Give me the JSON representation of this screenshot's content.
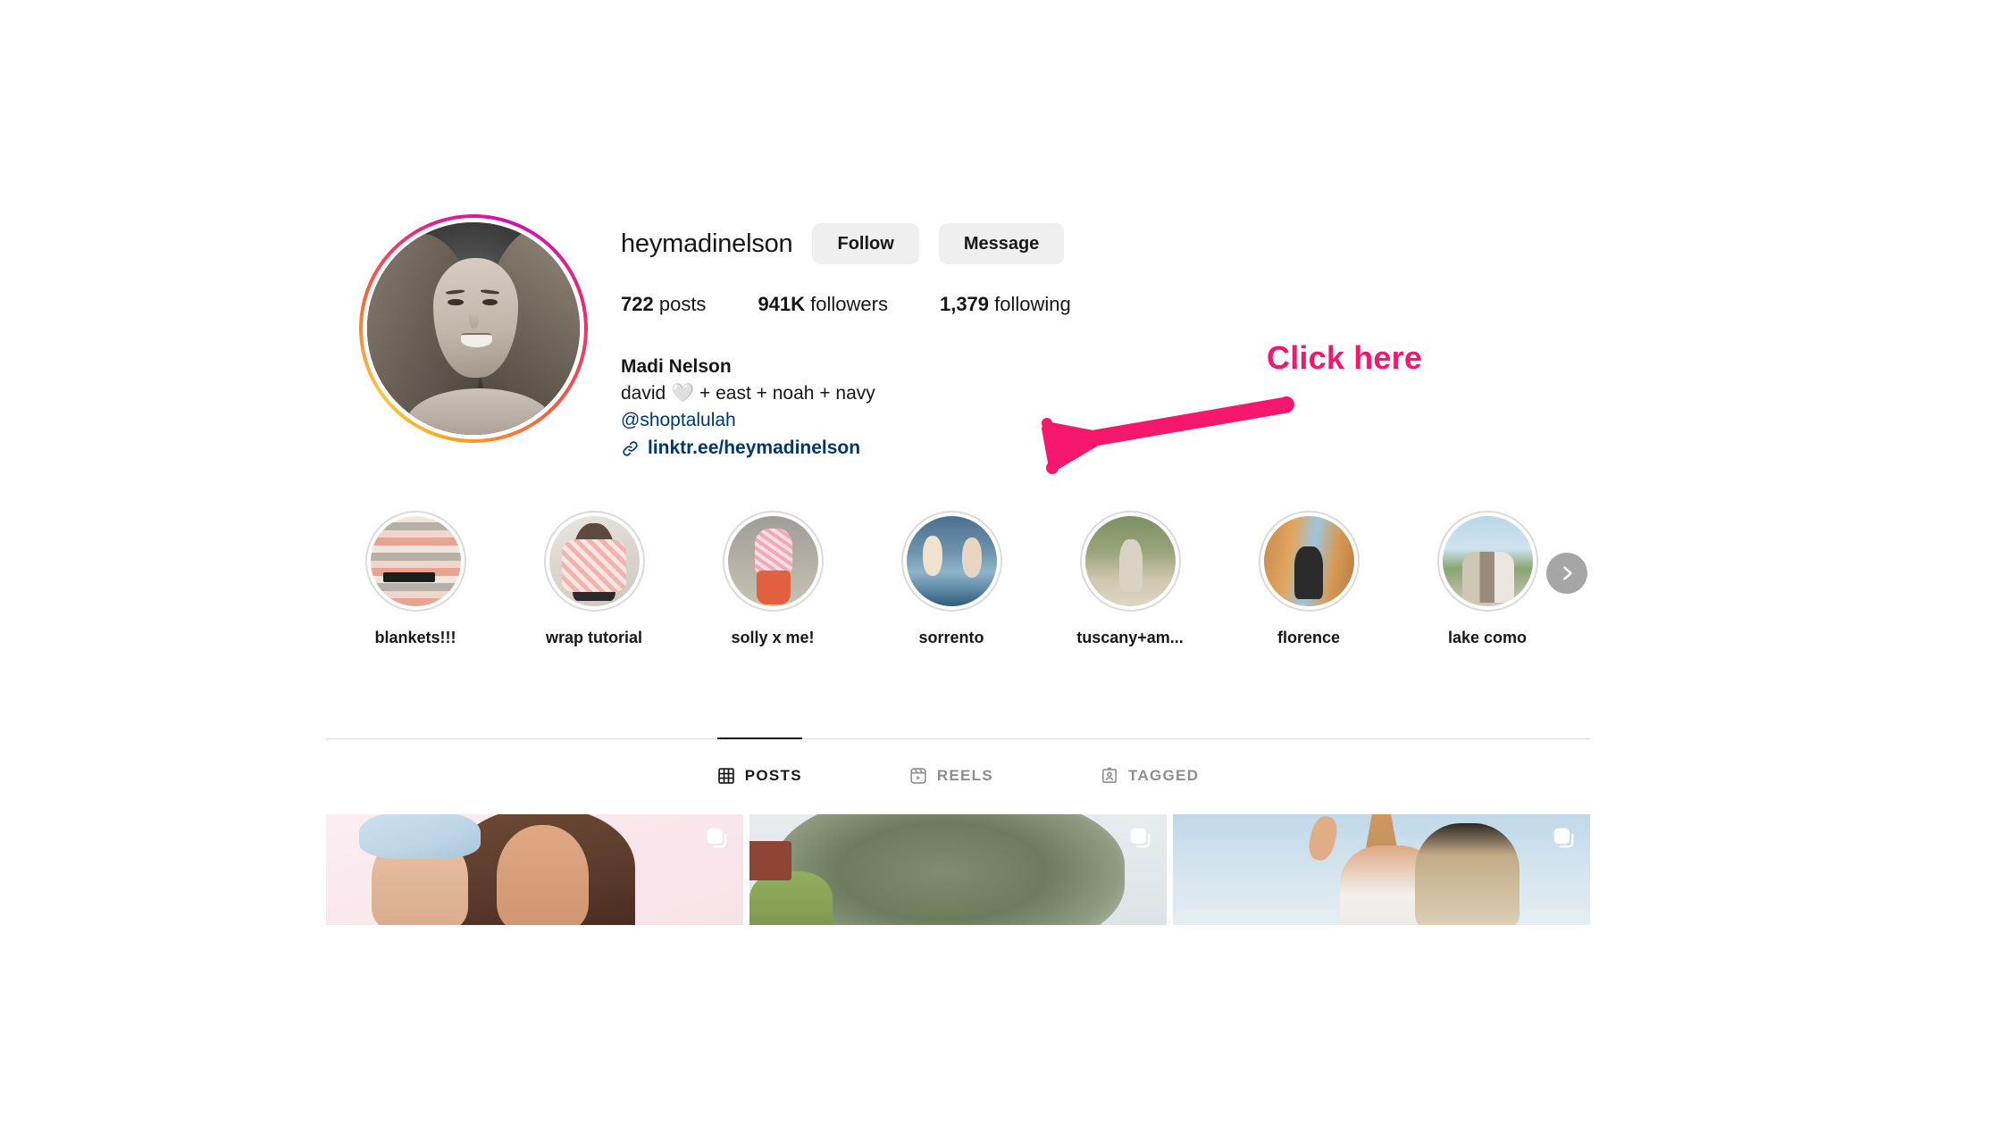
{
  "profile": {
    "username": "heymadinelson",
    "avatar_alt": "profile-photo",
    "actions": {
      "follow_label": "Follow",
      "message_label": "Message"
    },
    "stats": [
      {
        "value": "722",
        "label": "posts"
      },
      {
        "value": "941K",
        "label": "followers"
      },
      {
        "value": "1,379",
        "label": "following"
      }
    ],
    "bio": {
      "display_name": "Madi Nelson",
      "line_family": "david 🤍 + east + noah + navy",
      "mention": "@shoptalulah",
      "link": "linktr.ee/heymadinelson",
      "link_icon": "link-chain-icon"
    }
  },
  "annotation": {
    "label": "Click here",
    "color": "#f5176b",
    "arrow_icon": "arrow-left-icon"
  },
  "highlights": {
    "next_icon": "chevron-right-icon",
    "items": [
      {
        "label": "blankets!!!",
        "art": "t-blankets"
      },
      {
        "label": "wrap tutorial",
        "art": "t-wrap"
      },
      {
        "label": "solly x me!",
        "art": "t-solly"
      },
      {
        "label": "sorrento",
        "art": "t-sorrento"
      },
      {
        "label": "tuscany+am...",
        "art": "t-tuscany"
      },
      {
        "label": "florence",
        "art": "t-florence"
      },
      {
        "label": "lake como",
        "art": "t-lakecomo"
      }
    ]
  },
  "tabs": [
    {
      "label": "POSTS",
      "icon": "grid-icon",
      "active": true
    },
    {
      "label": "REELS",
      "icon": "reels-icon",
      "active": false
    },
    {
      "label": "TAGGED",
      "icon": "tagged-person-icon",
      "active": false
    }
  ],
  "posts": [
    {
      "name": "post-mother-and-baby",
      "art": "p1",
      "carousel": true,
      "carousel_icon": "carousel-icon"
    },
    {
      "name": "post-olive-tree",
      "art": "p2",
      "carousel": true,
      "carousel_icon": "carousel-icon"
    },
    {
      "name": "post-eiffel-tower-couple",
      "art": "p3",
      "carousel": true,
      "carousel_icon": "carousel-icon"
    }
  ],
  "colors": {
    "accent_pink": "#f5176b",
    "link_blue": "#00376b",
    "button_gray": "#efefef",
    "text_primary": "#171717",
    "text_muted": "#8e8e8e",
    "divider": "#dbdbdb"
  }
}
